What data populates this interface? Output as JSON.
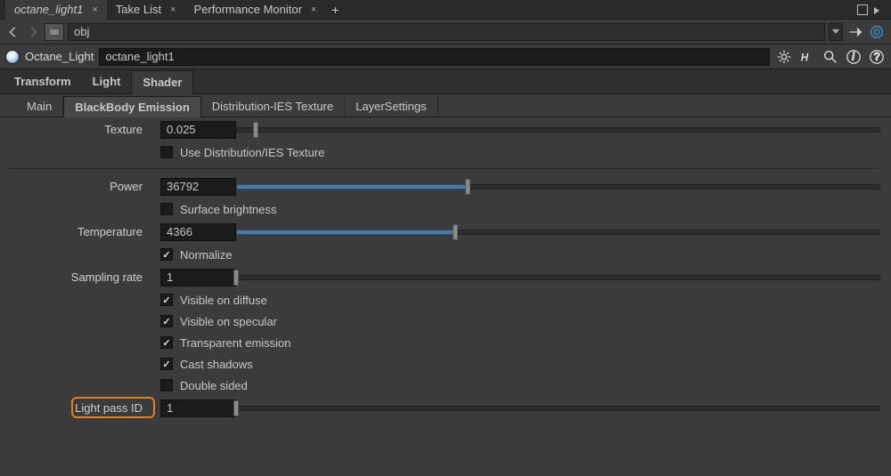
{
  "window_tabs": [
    "octane_light1",
    "Take List",
    "Performance Monitor"
  ],
  "active_window_tab": 0,
  "path": {
    "icon_label": "obj",
    "value": "obj"
  },
  "node": {
    "type": "Octane_Light",
    "name": "octane_light1"
  },
  "main_tabs": [
    "Transform",
    "Light",
    "Shader"
  ],
  "active_main_tab": 2,
  "sub_tabs": [
    "Main",
    "BlackBody Emission",
    "Distribution-IES Texture",
    "LayerSettings"
  ],
  "active_sub_tab": 1,
  "params": {
    "texture": {
      "label": "Texture",
      "value": "0.025",
      "slider_pct": 3
    },
    "use_dist": {
      "label": "Use Distribution/IES Texture",
      "checked": false
    },
    "power": {
      "label": "Power",
      "value": "36792",
      "slider_pct": 36
    },
    "surface_brightness": {
      "label": "Surface brightness",
      "checked": false
    },
    "temperature": {
      "label": "Temperature",
      "value": "4366",
      "slider_pct": 34
    },
    "normalize": {
      "label": "Normalize",
      "checked": true
    },
    "sampling_rate": {
      "label": "Sampling rate",
      "value": "1",
      "slider_pct": 0
    },
    "visible_diffuse": {
      "label": "Visible on diffuse",
      "checked": true
    },
    "visible_specular": {
      "label": "Visible on specular",
      "checked": true
    },
    "transparent_emission": {
      "label": "Transparent emission",
      "checked": true
    },
    "cast_shadows": {
      "label": "Cast shadows",
      "checked": true
    },
    "double_sided": {
      "label": "Double sided",
      "checked": false
    },
    "light_pass_id": {
      "label": "Light pass ID",
      "value": "1",
      "slider_pct": 0
    }
  }
}
